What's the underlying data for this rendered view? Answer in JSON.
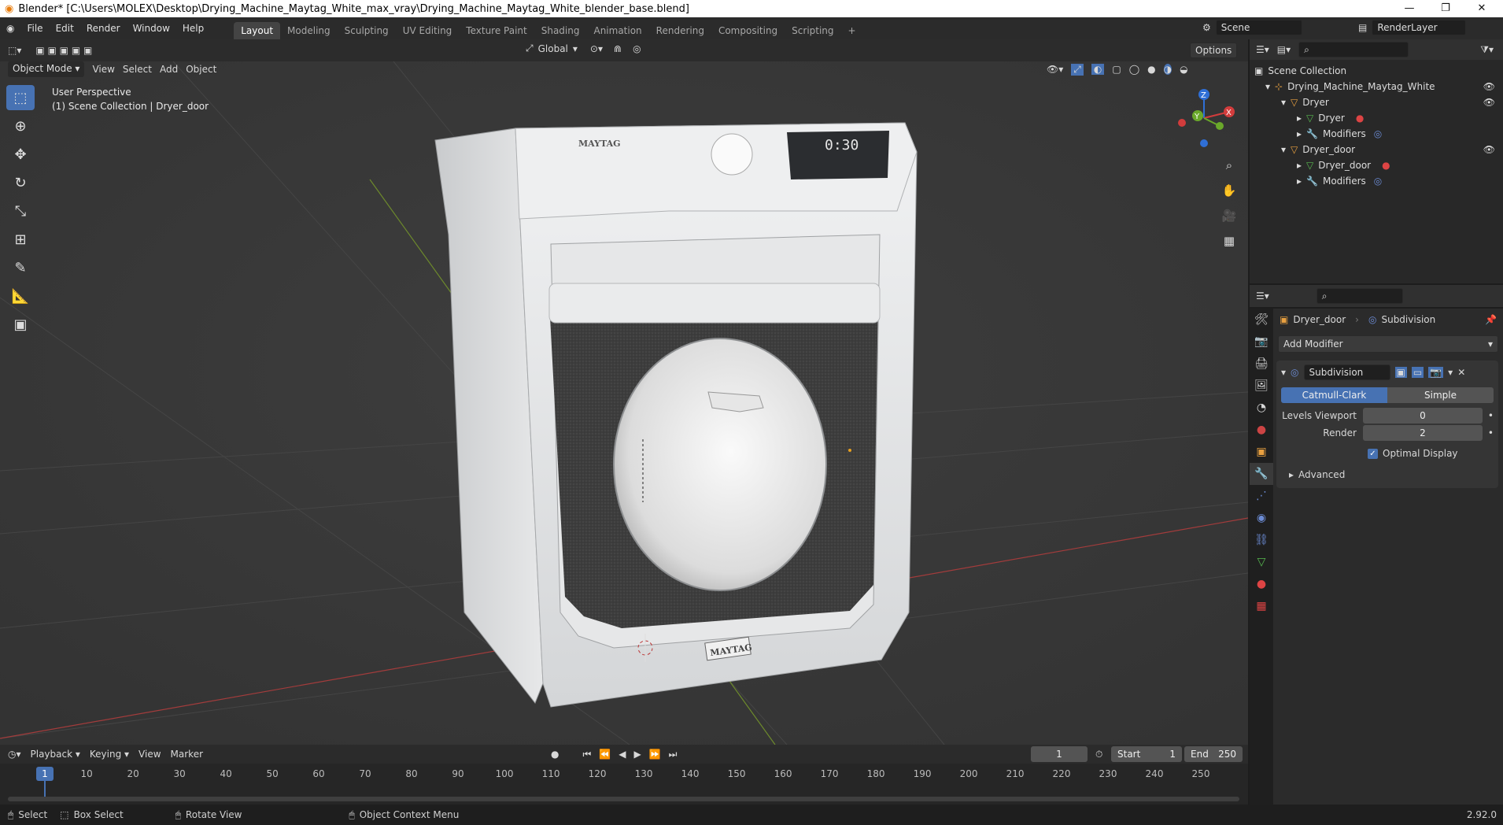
{
  "window": {
    "title": "Blender* [C:\\Users\\MOLEX\\Desktop\\Drying_Machine_Maytag_White_max_vray\\Drying_Machine_Maytag_White_blender_base.blend]"
  },
  "menu": [
    "File",
    "Edit",
    "Render",
    "Window",
    "Help"
  ],
  "workspaces": [
    "Layout",
    "Modeling",
    "Sculpting",
    "UV Editing",
    "Texture Paint",
    "Shading",
    "Animation",
    "Rendering",
    "Compositing",
    "Scripting"
  ],
  "active_workspace": "Layout",
  "scene": {
    "name": "Scene",
    "render_layer": "RenderLayer"
  },
  "viewport_header": {
    "mode": "Object Mode",
    "menus": [
      "View",
      "Select",
      "Add",
      "Object"
    ],
    "transform": "Global",
    "options": "Options"
  },
  "viewport_overlay": {
    "line1": "User Perspective",
    "line2": "(1) Scene Collection | Dryer_door"
  },
  "axes": {
    "x": "X",
    "y": "Y",
    "z": "Z"
  },
  "outliner": {
    "root": "Scene Collection",
    "items": [
      {
        "label": "Drying_Machine_Maytag_White",
        "depth": 1
      },
      {
        "label": "Dryer",
        "depth": 2
      },
      {
        "label": "Dryer",
        "depth": 3
      },
      {
        "label": "Modifiers",
        "depth": 3
      },
      {
        "label": "Dryer_door",
        "depth": 2
      },
      {
        "label": "Dryer_door",
        "depth": 3
      },
      {
        "label": "Modifiers",
        "depth": 3
      }
    ]
  },
  "properties": {
    "object": "Dryer_door",
    "modifier_crumb": "Subdivision",
    "add_modifier": "Add Modifier",
    "modifier_name": "Subdivision",
    "tabs": [
      "Catmull-Clark",
      "Simple"
    ],
    "levels_viewport_label": "Levels Viewport",
    "levels_viewport": "0",
    "render_label": "Render",
    "render": "2",
    "optimal_display": "Optimal Display",
    "advanced": "Advanced"
  },
  "timeline": {
    "menus": [
      "Playback",
      "Keying",
      "View",
      "Marker"
    ],
    "current_frame": "1",
    "start_label": "Start",
    "start": "1",
    "end_label": "End",
    "end": "250",
    "ticks": [
      "1",
      "10",
      "20",
      "30",
      "40",
      "50",
      "60",
      "70",
      "80",
      "90",
      "100",
      "110",
      "120",
      "130",
      "140",
      "150",
      "160",
      "170",
      "180",
      "190",
      "200",
      "210",
      "220",
      "230",
      "240",
      "250"
    ]
  },
  "statusbar": {
    "select": "Select",
    "box_select": "Box Select",
    "rotate": "Rotate View",
    "context": "Object Context Menu",
    "version": "2.92.0"
  },
  "product": {
    "brand": "MAYTAG"
  },
  "colors": {
    "accent": "#4772b3",
    "header": "#2b2b2b",
    "viewport": "#3a3a3a"
  }
}
